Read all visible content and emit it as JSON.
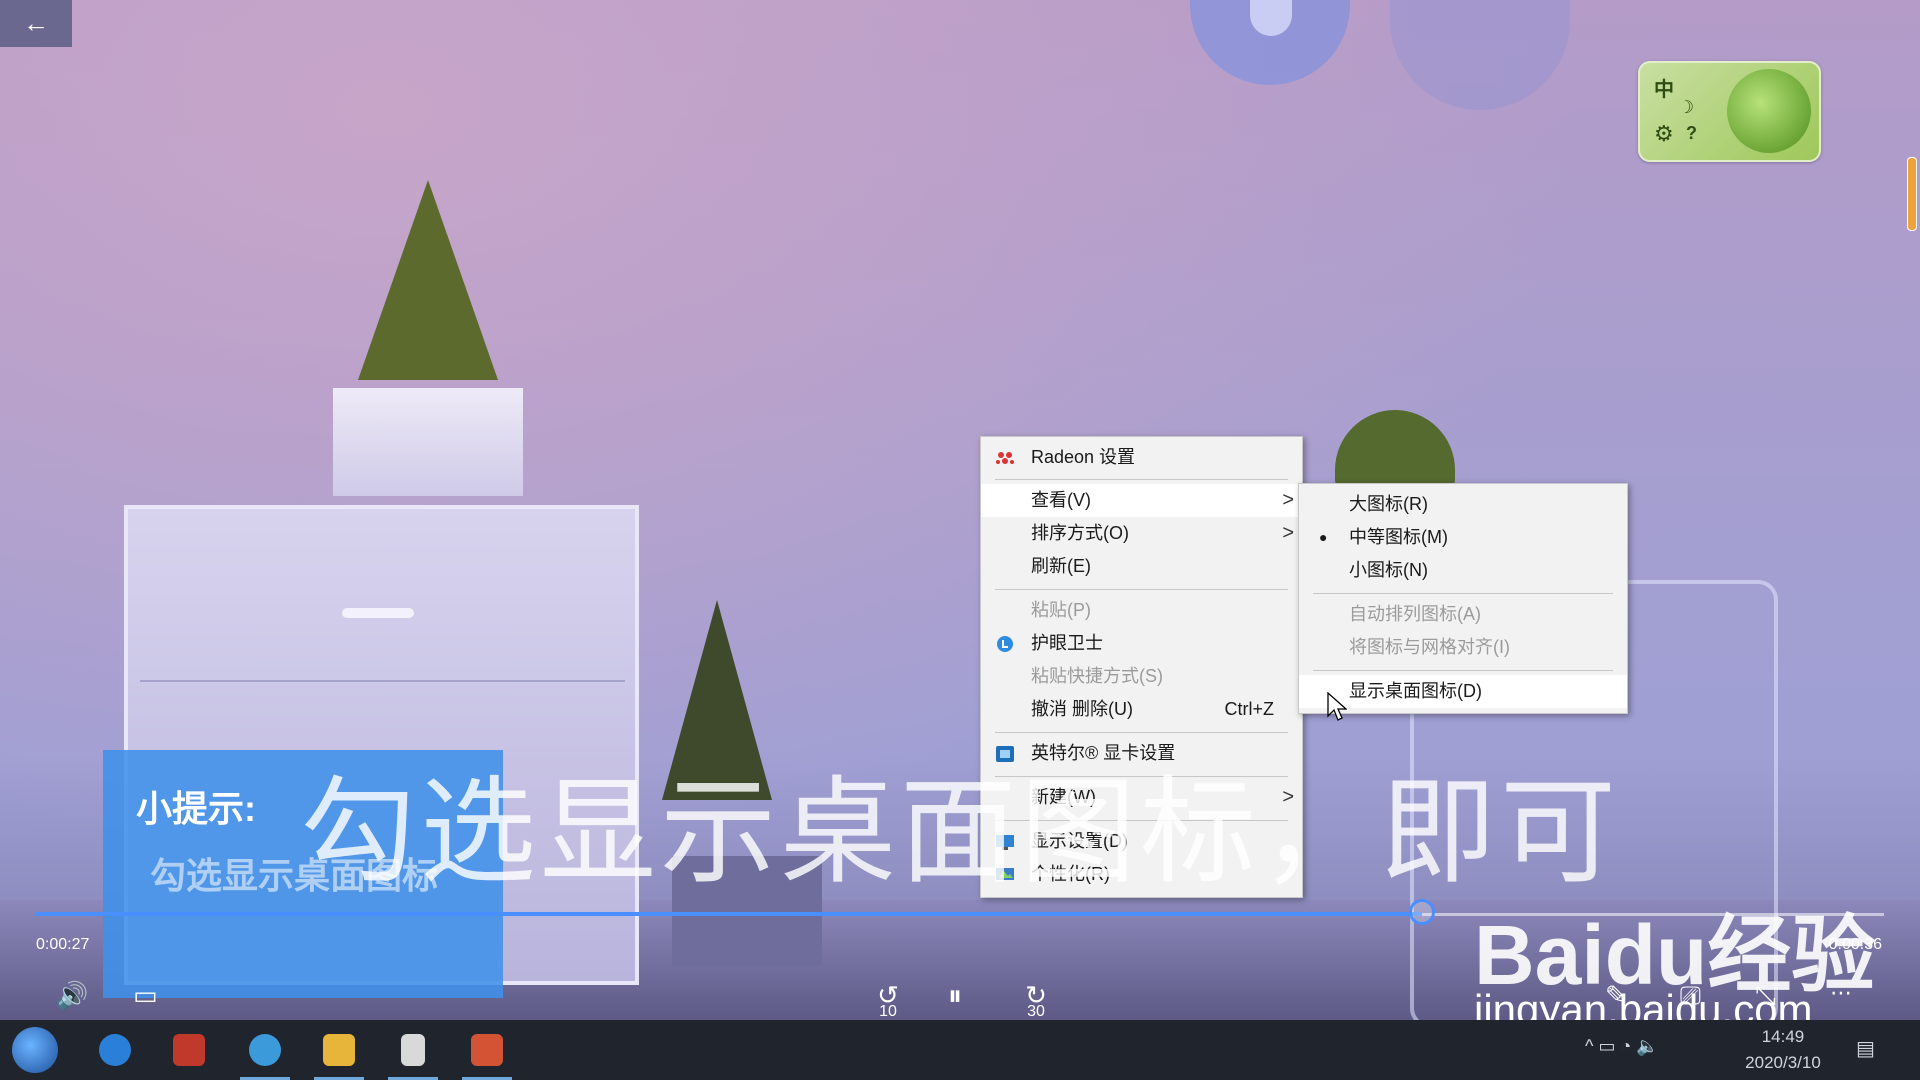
{
  "window": {
    "back_icon": "arrow-left-icon",
    "back_glyph": "←"
  },
  "ime": {
    "lang": "中",
    "moon": "☽",
    "gear": "⚙",
    "help": "?"
  },
  "context_menu": {
    "items": [
      {
        "label": "Radeon 设置",
        "icon": "radeon-icon"
      },
      {
        "label": "查看(V)",
        "submenu": true,
        "highlighted": true
      },
      {
        "label": "排序方式(O)",
        "submenu": true
      },
      {
        "label": "刷新(E)"
      },
      {
        "label": "粘贴(P)",
        "disabled": true
      },
      {
        "label": "护眼卫士",
        "icon": "eye-guard-icon"
      },
      {
        "label": "粘贴快捷方式(S)",
        "disabled": true
      },
      {
        "label": "撤消 删除(U)",
        "shortcut": "Ctrl+Z"
      },
      {
        "label": "英特尔® 显卡设置",
        "icon": "intel-graphics-icon"
      },
      {
        "label": "新建(W)",
        "submenu": true
      },
      {
        "label": "显示设置(D)",
        "icon": "display-settings-icon"
      },
      {
        "label": "个性化(R)",
        "icon": "personalize-icon"
      }
    ],
    "arrow": ">"
  },
  "view_submenu": {
    "items": [
      {
        "label": "大图标(R)"
      },
      {
        "label": "中等图标(M)",
        "selected": true
      },
      {
        "label": "小图标(N)"
      },
      {
        "label": "自动排列图标(A)",
        "disabled": true
      },
      {
        "label": "将图标与网格对齐(I)",
        "disabled": true
      },
      {
        "label": "显示桌面图标(D)",
        "highlighted": true
      }
    ],
    "bullet": "●"
  },
  "tip": {
    "label": "小提示:",
    "text": "勾选显示桌面图标",
    "caption": "勾选显示桌面图标，即可"
  },
  "player": {
    "current_time": "0:00:27",
    "total_time": "0:00:36",
    "progress": 0.75,
    "rewind_seconds": "10",
    "forward_seconds": "30",
    "volume_glyph": "🔊",
    "subtitle_glyph": "▭",
    "rewind_glyph": "↺",
    "pause_glyph": "⏸",
    "forward_glyph": "↻",
    "pen_glyph": "✎",
    "cast_glyph": "⎚",
    "fullscreen_glyph": "⤡",
    "more_glyph": "⋯"
  },
  "watermark": {
    "logo": "Baidu经验",
    "url": "jingyan.baidu.com"
  },
  "taskbar": {
    "apps": [
      {
        "name": "start",
        "color": "#2b6cc4"
      },
      {
        "name": "browser-icon",
        "color": "#2a7fd8"
      },
      {
        "name": "paint-icon",
        "color": "#c0392b"
      },
      {
        "name": "edge-icon",
        "color": "#3b9ad9"
      },
      {
        "name": "file-explorer-icon",
        "color": "#e7b53a"
      },
      {
        "name": "document-icon",
        "color": "#d9d9d9"
      },
      {
        "name": "presentation-icon",
        "color": "#d35435"
      }
    ],
    "tray_glyphs": "^  ▭  ◔  🔈",
    "time": "14:49",
    "date": "2020/3/10",
    "notification_glyph": "▤"
  }
}
